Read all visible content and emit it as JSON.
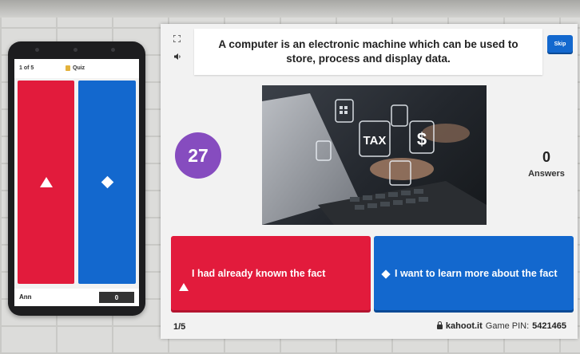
{
  "phone": {
    "counter": "1 of 5",
    "mode": "Quiz",
    "player_name": "Ann",
    "score": "0"
  },
  "game": {
    "question": "A computer is an electronic machine which can be used to store, process and display data.",
    "skip_label": "Skip",
    "timer": "27",
    "answers_count": "0",
    "answers_label": "Answers",
    "answers": [
      {
        "text": "I had already known the fact",
        "shape": "triangle",
        "color": "#e21b3c"
      },
      {
        "text": "I want to learn more about the fact",
        "shape": "diamond",
        "color": "#1368ce"
      }
    ],
    "progress": "1/5",
    "site": "kahoot.it",
    "pin_label": "Game PIN:",
    "pin": "5421465",
    "image_icons": [
      "TAX",
      "$"
    ]
  },
  "colors": {
    "red": "#e21b3c",
    "blue": "#1368ce",
    "purple": "#864cbf"
  }
}
